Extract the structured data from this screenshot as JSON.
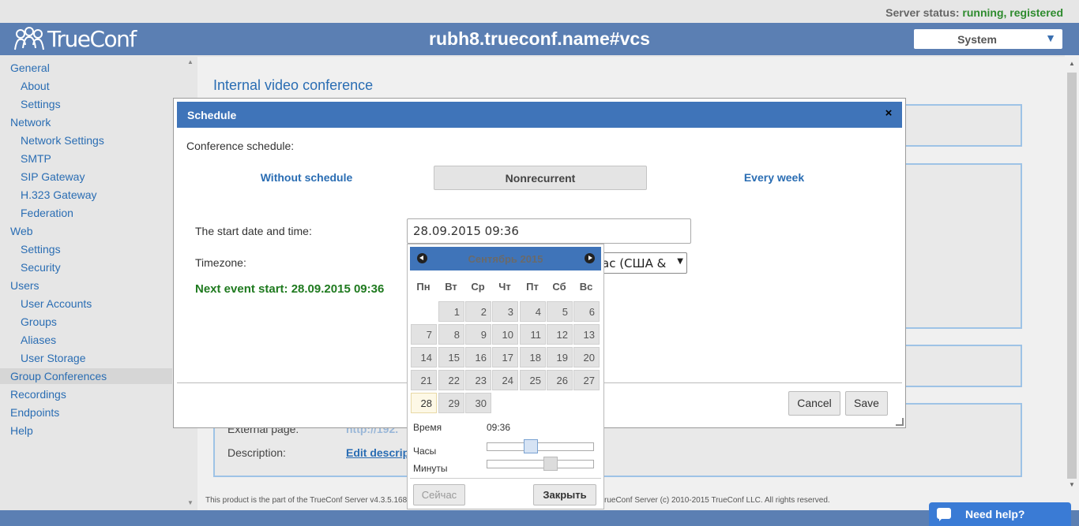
{
  "status": {
    "label": "Server status:",
    "value": "running, registered"
  },
  "header": {
    "logo_text": "TrueConf",
    "server_name": "rubh8.trueconf.name#vcs",
    "system_select": "System"
  },
  "sidebar": [
    {
      "label": "General"
    },
    {
      "label": "About"
    },
    {
      "label": "Settings"
    },
    {
      "label": "Network"
    },
    {
      "label": "Network Settings"
    },
    {
      "label": "SMTP"
    },
    {
      "label": "SIP Gateway"
    },
    {
      "label": "H.323 Gateway"
    },
    {
      "label": "Federation"
    },
    {
      "label": "Web"
    },
    {
      "label": "Settings"
    },
    {
      "label": "Security"
    },
    {
      "label": "Users"
    },
    {
      "label": "User Accounts"
    },
    {
      "label": "Groups"
    },
    {
      "label": "Aliases"
    },
    {
      "label": "User Storage"
    },
    {
      "label": "Group Conferences"
    },
    {
      "label": "Recordings"
    },
    {
      "label": "Endpoints"
    },
    {
      "label": "Help"
    }
  ],
  "main": {
    "title": "Internal video conference",
    "external_page_label": "External page:",
    "external_page_value": "http://192.",
    "description_label": "Description:",
    "description_link": "Edit descrip",
    "footer_left": "This product is the part of the TrueConf Server v4.3.5.168",
    "footer_right": "rueConf Server (c) 2010-2015 TrueConf LLC. All rights reserved."
  },
  "modal": {
    "title": "Schedule",
    "close": "×",
    "schedule_label": "Conference schedule:",
    "tabs": [
      {
        "label": "Without schedule"
      },
      {
        "label": "Nonrecurrent"
      },
      {
        "label": "Every week"
      }
    ],
    "start_label": "The start date and time:",
    "start_value": "28.09.2015 09:36",
    "timezone_label": "Timezone:",
    "timezone_value": "ас (США &",
    "next_event": "Next event start: 28.09.2015 09:36",
    "cancel": "Cancel",
    "save": "Save"
  },
  "datepicker": {
    "title": "Сентябрь 2015",
    "weekdays": [
      "Пн",
      "Вт",
      "Ср",
      "Чт",
      "Пт",
      "Сб",
      "Вс"
    ],
    "days": [
      "1",
      "2",
      "3",
      "4",
      "5",
      "6",
      "7",
      "8",
      "9",
      "10",
      "11",
      "12",
      "13",
      "14",
      "15",
      "16",
      "17",
      "18",
      "19",
      "20",
      "21",
      "22",
      "23",
      "24",
      "25",
      "26",
      "27",
      "28",
      "29",
      "30"
    ],
    "selected_day": "28",
    "time_label": "Время",
    "time_value": "09:36",
    "hours_label": "Часы",
    "minutes_label": "Минуты",
    "hours_level": 0.39,
    "minutes_level": 0.6,
    "now_button": "Сейчас",
    "close_button": "Закрыть"
  },
  "help": {
    "label": "Need help?"
  },
  "colors": {
    "header": "#5b7fb3",
    "accent": "#3f74b9",
    "link": "#2a6db3",
    "ok": "#2e8b2e"
  }
}
